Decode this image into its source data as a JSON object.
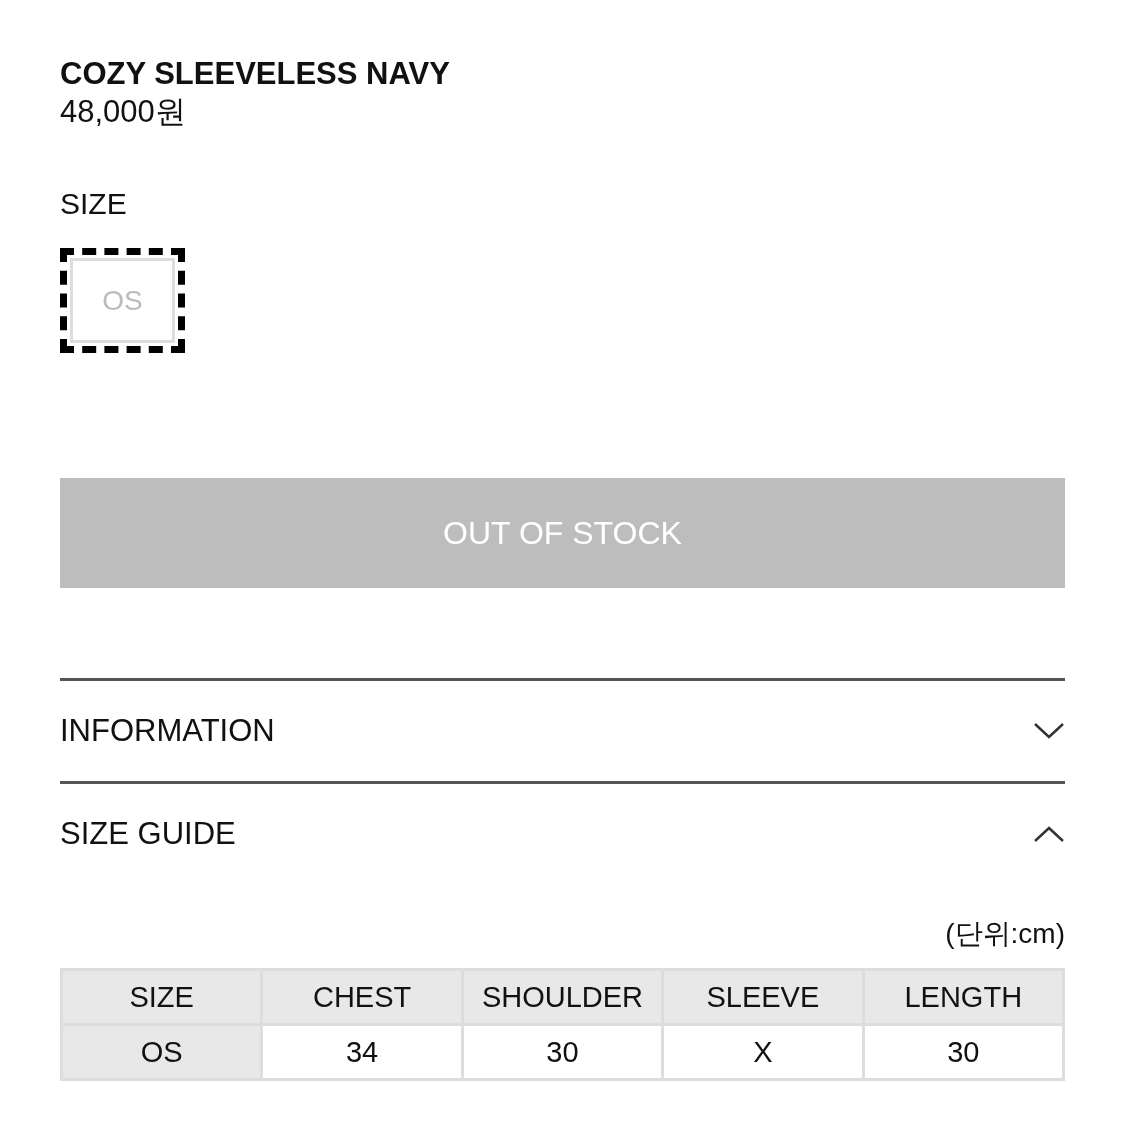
{
  "product": {
    "name": "COZY SLEEVELESS NAVY",
    "price": "48,000원"
  },
  "size": {
    "label": "SIZE",
    "options": [
      {
        "label": "OS",
        "selected": true,
        "disabled": true
      }
    ]
  },
  "buy_button": {
    "label": "OUT OF STOCK",
    "disabled": true
  },
  "sections": [
    {
      "title": "INFORMATION",
      "expanded": false
    },
    {
      "title": "SIZE GUIDE",
      "expanded": true
    }
  ],
  "size_guide": {
    "unit": "(단위:cm)",
    "columns": [
      "SIZE",
      "CHEST",
      "SHOULDER",
      "SLEEVE",
      "LENGTH"
    ],
    "rows": [
      [
        "OS",
        "34",
        "30",
        "X",
        "30"
      ]
    ]
  }
}
